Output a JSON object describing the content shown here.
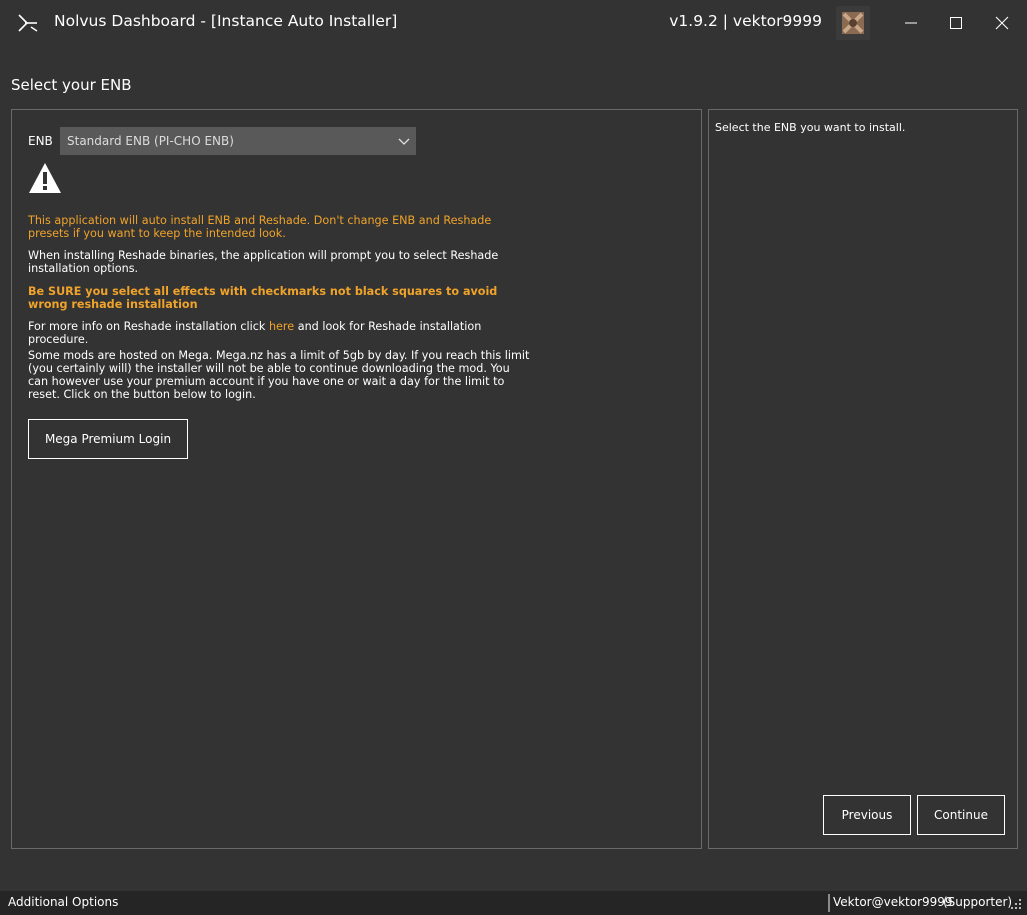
{
  "titlebar": {
    "title": "Nolvus Dashboard - [Instance Auto Installer]",
    "version_user": "v1.9.2 | vektor9999"
  },
  "page": {
    "title": "Select your ENB"
  },
  "enb": {
    "label": "ENB",
    "selected": "Standard ENB (PI-CHO ENB)"
  },
  "info": {
    "p1": "This application will auto install ENB and Reshade. Don't change ENB and Reshade presets if you want to keep the intended look.",
    "p2": "When installing Reshade binaries, the application will prompt you to select Reshade installation options.",
    "p3": "Be SURE you select all effects with checkmarks not black squares to avoid wrong reshade installation",
    "p4_before": "For more info on Reshade installation click ",
    "p4_link": "here",
    "p4_after": "  and look for Reshade installation procedure.",
    "p5": "Some mods are hosted on Mega. Mega.nz has a limit of 5gb by day. If you reach this limit (you certainly will) the installer will not be able to continue downloading the mod. You can however use your premium account if you have one or wait a day for the limit to reset. Click on the button below to login."
  },
  "buttons": {
    "mega_login": "Mega Premium Login",
    "previous": "Previous",
    "continue": "Continue"
  },
  "help": {
    "text": "Select the ENB you want to install."
  },
  "statusbar": {
    "left": "Additional Options",
    "user": "Vektor@vektor9999",
    "role": "(Supporter)"
  },
  "colors": {
    "background": "#333333",
    "accent_orange": "#f0a32a",
    "statusbar": "#252525"
  }
}
